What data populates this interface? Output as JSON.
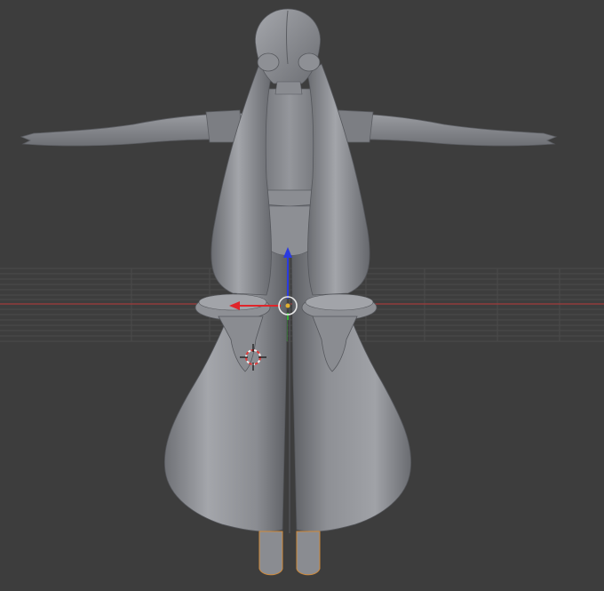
{
  "viewport": {
    "view": "back-orthographic",
    "shading": "solid",
    "background_color": "#3d3d3d",
    "grid_color": "#4a4a4a",
    "x_axis_color": "#a33c3c",
    "y_axis_color": "#3c8a3c"
  },
  "object": {
    "name": "",
    "type": "mesh",
    "pose": "T-pose",
    "selected": false,
    "base_color": "#8f9196",
    "outline_color": "#d08a3a"
  },
  "gizmo": {
    "type": "translate-manipulator",
    "x_color": "#e0252a",
    "z_color": "#2b3be0",
    "y_color": "#35b035",
    "center_ring_color": "#e8e8e8"
  },
  "cursor_3d": {
    "icon": "3d-cursor-icon",
    "ring_colors": [
      "#e03a3a",
      "#f0f0f0"
    ]
  }
}
